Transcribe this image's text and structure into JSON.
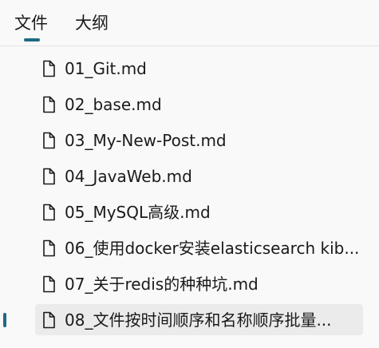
{
  "tabs": {
    "files_label": "文件",
    "outline_label": "大纲",
    "active": "files"
  },
  "files": [
    {
      "name": "01_Git.md",
      "icon": "file-icon"
    },
    {
      "name": "02_base.md",
      "icon": "file-icon"
    },
    {
      "name": "03_My-New-Post.md",
      "icon": "file-icon"
    },
    {
      "name": "04_JavaWeb.md",
      "icon": "file-icon"
    },
    {
      "name": "05_MySQL高级.md",
      "icon": "file-icon"
    },
    {
      "name": "06_使用docker安装elasticsearch kib...",
      "icon": "file-icon"
    },
    {
      "name": "07_关于redis的种种坑.md",
      "icon": "file-icon"
    },
    {
      "name": "08_文件按时间顺序和名称顺序批量...",
      "icon": "file-icon",
      "selected": true
    }
  ],
  "colors": {
    "accent": "#1f6a83",
    "selected_background": "#ebebeb",
    "panel_background": "#f9f9f9"
  }
}
